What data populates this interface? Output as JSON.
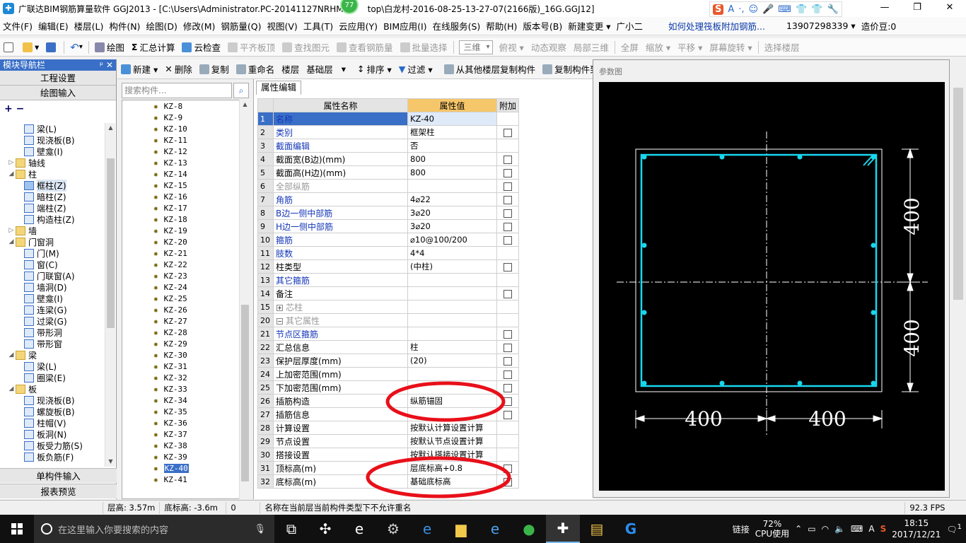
{
  "window": {
    "title": "广联达BIM钢筋算量软件 GGJ2013 - [C:\\Users\\Administrator.PC-20141127NRHM",
    "title_tail": "top\\白龙村-2016-08-25-13-27-07(2166版)_16G.GGJ12]",
    "badge": "77",
    "ime": [
      "S",
      "A",
      "·,",
      "☺",
      "🎤",
      "⌨",
      "👕",
      "👕",
      "🔧"
    ],
    "controls": [
      "—",
      "❐",
      "✕"
    ]
  },
  "menu": {
    "items": [
      "文件(F)",
      "编辑(E)",
      "楼层(L)",
      "构件(N)",
      "绘图(D)",
      "修改(M)",
      "钢筋量(Q)",
      "视图(V)",
      "工具(T)",
      "云应用(Y)",
      "BIM应用(I)",
      "在线服务(S)",
      "帮助(H)",
      "版本号(B)",
      "新建变更 ▾",
      "广小二"
    ],
    "help_link": "如何处理筏板附加钢筋...",
    "phone": "13907298339 ▾",
    "price": "造价豆:0"
  },
  "toolbar": {
    "items": [
      "绘图",
      "汇总计算",
      "云检查",
      "平齐板顶",
      "查找图元",
      "查看钢筋量",
      "批量选择"
    ],
    "view_combo": "三维",
    "items2": [
      "俯视 ▾",
      "动态观察",
      "局部三维",
      "全屏",
      "缩放 ▾",
      "平移 ▾",
      "屏幕旋转 ▾",
      "选择楼层"
    ]
  },
  "left_panel": {
    "title": "模块导航栏",
    "pin": "ᵖ",
    "close": "✕",
    "top_buttons": [
      "工程设置",
      "绘图输入"
    ],
    "plus_minus": "+ −",
    "bottom_buttons": [
      "单构件输入",
      "报表预览"
    ],
    "tree": [
      {
        "depth": 3,
        "label": "梁(L)",
        "icon": "beam-icon"
      },
      {
        "depth": 3,
        "label": "现浇板(B)",
        "icon": "slab-icon"
      },
      {
        "depth": 3,
        "label": "壁龛(I)",
        "icon": "niche-icon"
      },
      {
        "depth": 1,
        "label": "轴线",
        "folder": true,
        "glyph": "▷"
      },
      {
        "depth": 1,
        "label": "柱",
        "folder": true,
        "glyph": "◢"
      },
      {
        "depth": 3,
        "label": "框柱(Z)",
        "icon": "column-icon",
        "selected": true
      },
      {
        "depth": 3,
        "label": "暗柱(Z)",
        "icon": "column-icon"
      },
      {
        "depth": 3,
        "label": "端柱(Z)",
        "icon": "column-icon"
      },
      {
        "depth": 3,
        "label": "构造柱(Z)",
        "icon": "column-icon"
      },
      {
        "depth": 1,
        "label": "墙",
        "folder": true,
        "glyph": "▷"
      },
      {
        "depth": 1,
        "label": "门窗洞",
        "folder": true,
        "glyph": "◢"
      },
      {
        "depth": 3,
        "label": "门(M)",
        "icon": "door-icon"
      },
      {
        "depth": 3,
        "label": "窗(C)",
        "icon": "window-icon"
      },
      {
        "depth": 3,
        "label": "门联窗(A)",
        "icon": "door-window-icon"
      },
      {
        "depth": 3,
        "label": "墙洞(D)",
        "icon": "wall-hole-icon"
      },
      {
        "depth": 3,
        "label": "壁龛(I)",
        "icon": "niche-icon"
      },
      {
        "depth": 3,
        "label": "连梁(G)",
        "icon": "link-beam-icon"
      },
      {
        "depth": 3,
        "label": "过梁(G)",
        "icon": "lintel-icon"
      },
      {
        "depth": 3,
        "label": "带形洞",
        "icon": "strip-hole-icon"
      },
      {
        "depth": 3,
        "label": "带形窗",
        "icon": "strip-window-icon"
      },
      {
        "depth": 1,
        "label": "梁",
        "folder": true,
        "glyph": "◢"
      },
      {
        "depth": 3,
        "label": "梁(L)",
        "icon": "beam-icon"
      },
      {
        "depth": 3,
        "label": "圈梁(E)",
        "icon": "ring-beam-icon"
      },
      {
        "depth": 1,
        "label": "板",
        "folder": true,
        "glyph": "◢"
      },
      {
        "depth": 3,
        "label": "现浇板(B)",
        "icon": "slab-icon"
      },
      {
        "depth": 3,
        "label": "螺旋板(B)",
        "icon": "spiral-slab-icon"
      },
      {
        "depth": 3,
        "label": "柱帽(V)",
        "icon": "column-cap-icon"
      },
      {
        "depth": 3,
        "label": "板洞(N)",
        "icon": "slab-hole-icon"
      },
      {
        "depth": 3,
        "label": "板受力筋(S)",
        "icon": "slab-rebar-icon"
      },
      {
        "depth": 3,
        "label": "板负筋(F)",
        "icon": "slab-neg-rebar-icon"
      }
    ]
  },
  "component_toolbar": {
    "items": [
      "新建 ▾",
      "删除",
      "复制",
      "重命名",
      "楼层",
      "基础层",
      "排序 ▾",
      "过滤 ▾",
      "从其他楼层复制构件",
      "复制构件到"
    ]
  },
  "component_list": {
    "search_placeholder": "搜索构件...",
    "items": [
      "KZ-8",
      "KZ-9",
      "KZ-10",
      "KZ-11",
      "KZ-12",
      "KZ-13",
      "KZ-14",
      "KZ-15",
      "KZ-16",
      "KZ-17",
      "KZ-18",
      "KZ-19",
      "KZ-20",
      "KZ-21",
      "KZ-22",
      "KZ-23",
      "KZ-24",
      "KZ-25",
      "KZ-26",
      "KZ-27",
      "KZ-28",
      "KZ-29",
      "KZ-30",
      "KZ-31",
      "KZ-32",
      "KZ-33",
      "KZ-34",
      "KZ-35",
      "KZ-36",
      "KZ-37",
      "KZ-38",
      "KZ-39",
      "KZ-40",
      "KZ-41"
    ],
    "selected": "KZ-40"
  },
  "property_editor": {
    "tab": "属性编辑",
    "headers": [
      "属性名称",
      "属性值",
      "附加"
    ],
    "rows": [
      {
        "n": "1",
        "name": "名称",
        "val": "KZ-40",
        "style": "blue",
        "chk": false,
        "sel": true
      },
      {
        "n": "2",
        "name": "类别",
        "val": "框架柱",
        "style": "blue",
        "chk": true
      },
      {
        "n": "3",
        "name": "截面编辑",
        "val": "否",
        "style": "blue",
        "chk": false
      },
      {
        "n": "4",
        "name": "截面宽(B边)(mm)",
        "val": "800",
        "style": "",
        "chk": true
      },
      {
        "n": "5",
        "name": "截面高(H边)(mm)",
        "val": "800",
        "style": "",
        "chk": true
      },
      {
        "n": "6",
        "name": "全部纵筋",
        "val": "",
        "style": "gray",
        "chk": true
      },
      {
        "n": "7",
        "name": "角筋",
        "val": "4⌀22",
        "style": "blue",
        "chk": true
      },
      {
        "n": "8",
        "name": "B边一侧中部筋",
        "val": "3⌀20",
        "style": "blue",
        "chk": true
      },
      {
        "n": "9",
        "name": "H边一侧中部筋",
        "val": "3⌀20",
        "style": "blue",
        "chk": true
      },
      {
        "n": "10",
        "name": "箍筋",
        "val": "⌀10@100/200",
        "style": "blue",
        "chk": true
      },
      {
        "n": "11",
        "name": "肢数",
        "val": "4*4",
        "style": "blue",
        "chk": false
      },
      {
        "n": "12",
        "name": "柱类型",
        "val": "(中柱)",
        "style": "",
        "chk": true
      },
      {
        "n": "13",
        "name": "其它箍筋",
        "val": "",
        "style": "blue",
        "chk": false
      },
      {
        "n": "14",
        "name": "备注",
        "val": "",
        "style": "",
        "chk": true
      },
      {
        "n": "15",
        "name": "芯柱",
        "val": "",
        "style": "gray",
        "exp": "+",
        "chk": false
      },
      {
        "n": "20",
        "name": "其它属性",
        "val": "",
        "style": "gray",
        "exp": "−",
        "chk": false
      },
      {
        "n": "21",
        "name": "节点区箍筋",
        "val": "",
        "style": "blue",
        "indent": true,
        "chk": true
      },
      {
        "n": "22",
        "name": "汇总信息",
        "val": "柱",
        "style": "",
        "indent": true,
        "chk": true
      },
      {
        "n": "23",
        "name": "保护层厚度(mm)",
        "val": "(20)",
        "style": "",
        "indent": true,
        "chk": true
      },
      {
        "n": "24",
        "name": "上加密范围(mm)",
        "val": "",
        "style": "",
        "indent": true,
        "chk": true
      },
      {
        "n": "25",
        "name": "下加密范围(mm)",
        "val": "",
        "style": "",
        "indent": true,
        "chk": true
      },
      {
        "n": "26",
        "name": "插筋构造",
        "val": "纵筋锚固",
        "style": "",
        "indent": true,
        "chk": true
      },
      {
        "n": "27",
        "name": "插筋信息",
        "val": "",
        "style": "",
        "indent": true,
        "chk": true
      },
      {
        "n": "28",
        "name": "计算设置",
        "val": "按默认计算设置计算",
        "style": "",
        "indent": true,
        "chk": false
      },
      {
        "n": "29",
        "name": "节点设置",
        "val": "按默认节点设置计算",
        "style": "",
        "indent": true,
        "chk": false
      },
      {
        "n": "30",
        "name": "搭接设置",
        "val": "按默认搭接设置计算",
        "style": "",
        "indent": true,
        "chk": false
      },
      {
        "n": "31",
        "name": "顶标高(m)",
        "val": "层底标高+0.8",
        "style": "",
        "indent": true,
        "chk": true
      },
      {
        "n": "32",
        "name": "底标高(m)",
        "val": "基础底标高",
        "style": "",
        "indent": true,
        "chk": true
      }
    ]
  },
  "diagram": {
    "title": "参数图",
    "dim_right_top": "400",
    "dim_right_bottom": "400",
    "dim_bottom_left": "400",
    "dim_bottom_right": "400"
  },
  "status": {
    "floor_height": "层高: 3.57m",
    "bottom_elev": "底标高: -3.6m",
    "zero": "0",
    "message": "名称在当前层当前构件类型下不允许重名",
    "fps": "92.3 FPS"
  },
  "taskbar": {
    "search_placeholder": "在这里输入你要搜索的内容",
    "link_label": "链接",
    "cpu_pct": "72%",
    "cpu_label": "CPU使用",
    "ime_label": "A",
    "time": "18:15",
    "date": "2017/12/21",
    "notif": "1"
  }
}
